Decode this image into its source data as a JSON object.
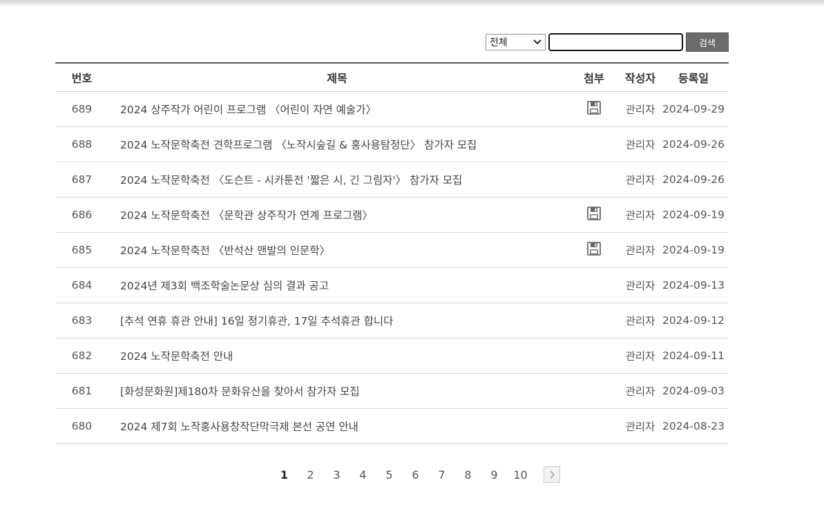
{
  "search": {
    "category_selected": "전체",
    "query_value": "",
    "button_label": "검색"
  },
  "table": {
    "headers": {
      "number": "번호",
      "title": "제목",
      "attachment": "첨부",
      "author": "작성자",
      "date": "등록일"
    },
    "rows": [
      {
        "number": "689",
        "title": "2024 상주작가 어린이 프로그램 〈어린이 자연 예술가〉",
        "attachment": true,
        "author": "관리자",
        "date": "2024-09-29"
      },
      {
        "number": "688",
        "title": "2024 노작문학축전 견학프로그램 〈노작시숲길 & 홍사용탐정단〉 참가자 모집",
        "attachment": false,
        "author": "관리자",
        "date": "2024-09-26"
      },
      {
        "number": "687",
        "title": "2024 노작문학축전 〈도슨트 - 시카툰전 '짧은 시, 긴 그림자'〉 참가자 모집",
        "attachment": false,
        "author": "관리자",
        "date": "2024-09-26"
      },
      {
        "number": "686",
        "title": "2024 노작문학축전 〈문학관 상주작가 연계 프로그램〉",
        "attachment": true,
        "author": "관리자",
        "date": "2024-09-19"
      },
      {
        "number": "685",
        "title": "2024 노작문학축전 〈반석산 맨발의 인문학〉",
        "attachment": true,
        "author": "관리자",
        "date": "2024-09-19"
      },
      {
        "number": "684",
        "title": "2024년 제3회 백조학술논문상 심의 결과 공고",
        "attachment": false,
        "author": "관리자",
        "date": "2024-09-13"
      },
      {
        "number": "683",
        "title": "[추석 연휴 휴관 안내] 16일 정기휴관, 17일 추석휴관 합니다",
        "attachment": false,
        "author": "관리자",
        "date": "2024-09-12"
      },
      {
        "number": "682",
        "title": "2024 노작문학축전 안내",
        "attachment": false,
        "author": "관리자",
        "date": "2024-09-11"
      },
      {
        "number": "681",
        "title": "[화성문화원]제180차 문화유산을 찾아서 참가자 모집",
        "attachment": false,
        "author": "관리자",
        "date": "2024-09-03"
      },
      {
        "number": "680",
        "title": "2024 제7회 노작홍사용창작단막극제 본선 공연 안내",
        "attachment": false,
        "author": "관리자",
        "date": "2024-08-23"
      }
    ]
  },
  "pagination": {
    "current": "1",
    "pages": [
      "1",
      "2",
      "3",
      "4",
      "5",
      "6",
      "7",
      "8",
      "9",
      "10"
    ],
    "next_icon": "chevron-right-icon"
  }
}
